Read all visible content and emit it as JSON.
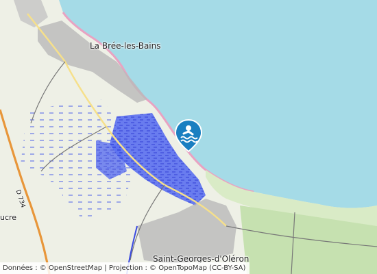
{
  "map": {
    "places": {
      "town_north": "La Brée-les-Bains",
      "town_south": "Saint-Georges-d'Oléron",
      "partial_west": "ucre"
    },
    "road_label": "D 734",
    "marker": {
      "icon": "swimming-beach-icon",
      "color": "#1a7fc1"
    },
    "colors": {
      "sea": "#a8dce8",
      "marsh": "#3d52e0",
      "land": "#eef0e6",
      "road_primary": "#e8963a"
    },
    "attribution": "Données : © OpenStreetMap | Projection : © OpenTopoMap (CC-BY-SA)"
  }
}
